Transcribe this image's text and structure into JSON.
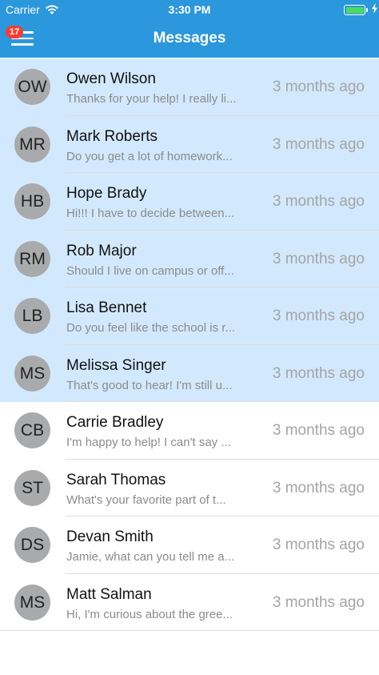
{
  "status_bar": {
    "carrier": "Carrier",
    "time": "3:30 PM",
    "wifi_icon": "wifi-icon",
    "battery_icon": "battery-icon",
    "charging_icon": "charging-bolt-icon",
    "battery_color": "#4cd964"
  },
  "nav": {
    "title": "Messages",
    "menu_icon": "hamburger-icon",
    "badge_count": "17",
    "bar_color": "#2b97dc"
  },
  "messages": [
    {
      "initials": "OW",
      "name": "Owen Wilson",
      "preview": "Thanks for your help! I really li...",
      "time": "3 months ago",
      "unread": true
    },
    {
      "initials": "MR",
      "name": "Mark Roberts",
      "preview": "Do you get a lot of homework...",
      "time": "3 months ago",
      "unread": true
    },
    {
      "initials": "HB",
      "name": "Hope Brady",
      "preview": "Hi!!! I have to decide between...",
      "time": "3 months ago",
      "unread": true
    },
    {
      "initials": "RM",
      "name": "Rob Major",
      "preview": "Should I live on campus or off...",
      "time": "3 months ago",
      "unread": true
    },
    {
      "initials": "LB",
      "name": "Lisa Bennet",
      "preview": "Do you feel like the school is r...",
      "time": "3 months ago",
      "unread": true
    },
    {
      "initials": "MS",
      "name": "Melissa Singer",
      "preview": "That's good to hear! I'm still u...",
      "time": "3 months ago",
      "unread": true
    },
    {
      "initials": "CB",
      "name": "Carrie Bradley",
      "preview": "I'm happy to help! I can't say ...",
      "time": "3 months ago",
      "unread": false
    },
    {
      "initials": "ST",
      "name": "Sarah Thomas",
      "preview": "What's your favorite part of t...",
      "time": "3 months ago",
      "unread": false
    },
    {
      "initials": "DS",
      "name": "Devan Smith",
      "preview": "Jamie, what can you tell me a...",
      "time": "3 months ago",
      "unread": false
    },
    {
      "initials": "MS",
      "name": "Matt Salman",
      "preview": "Hi, I'm curious about the gree...",
      "time": "3 months ago",
      "unread": false
    }
  ],
  "colors": {
    "unread_row": "#d2e9fd",
    "read_row": "#ffffff",
    "avatar": "#a9aaab",
    "badge": "#ff3b30"
  }
}
